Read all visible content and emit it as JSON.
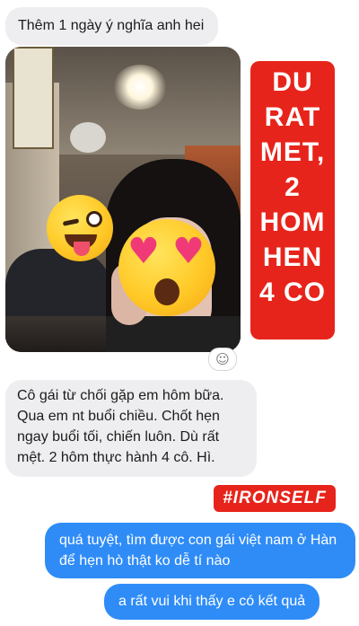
{
  "messages": {
    "msg1": "Thêm 1 ngày ý nghĩa anh hei",
    "msg2": "Cô gái từ chối gặp em hôm bữa. Qua em nt buổi chiều. Chốt hẹn ngay buổi tối, chiến luôn. Dù rất mệt. 2 hôm thực hành 4 cô. Hì.",
    "msg3": "quá tuyệt, tìm được con gái việt nam ở Hàn để hẹn hò thật ko dễ tí nào",
    "msg4": "a rất vui khi thấy e có kết quả"
  },
  "overlay": {
    "lines": [
      "DU",
      "RAT",
      "MET,",
      "2",
      "HOM",
      "HEN",
      "4 CO"
    ]
  },
  "hashtag": "#IRONSELF",
  "icons": {
    "reaction": "add-reaction-icon",
    "wink_emoji": "winking-face-with-tongue-emoji",
    "heart_eyes_emoji": "heart-eyes-emoji"
  },
  "colors": {
    "incoming_bubble": "#eeeef0",
    "outgoing_bubble": "#2f8cf7",
    "overlay_red": "#e7241b"
  }
}
